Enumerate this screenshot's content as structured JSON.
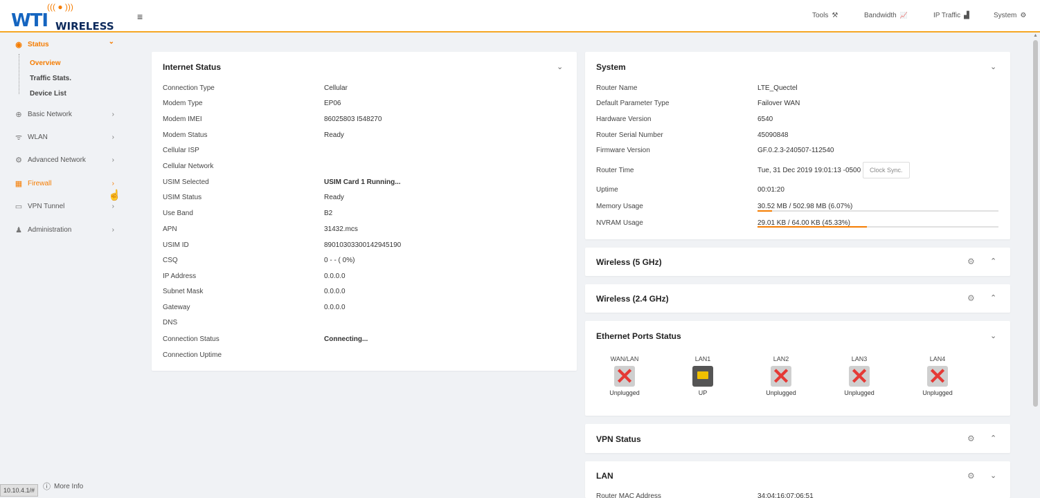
{
  "brand": {
    "logo_main": "WTI",
    "logo_sub": "WIRELESS",
    "logo_waves": "((( ● )))"
  },
  "topnav": [
    {
      "label": "Tools",
      "icon": "⚒"
    },
    {
      "label": "Bandwidth",
      "icon": "📈"
    },
    {
      "label": "IP Traffic",
      "icon": "▟"
    },
    {
      "label": "System",
      "icon": "⚙"
    }
  ],
  "sidebar": {
    "items": [
      {
        "label": "Status",
        "icon": "◉",
        "chev": "⌄"
      },
      {
        "label": "Basic Network",
        "icon": "⊕",
        "chev": "›"
      },
      {
        "label": "WLAN",
        "icon": "ᯤ",
        "chev": "›"
      },
      {
        "label": "Advanced Network",
        "icon": "⚙",
        "chev": "›"
      },
      {
        "label": "Firewall",
        "icon": "▦",
        "chev": "›"
      },
      {
        "label": "VPN Tunnel",
        "icon": "▭",
        "chev": "›"
      },
      {
        "label": "Administration",
        "icon": "♟",
        "chev": "›"
      }
    ],
    "sub_items": [
      "Overview",
      "Traffic Stats.",
      "Device List"
    ],
    "more_info": "More Info",
    "url": "10.10.4.1/#"
  },
  "internet_status": {
    "title": "Internet Status",
    "rows": [
      {
        "label": "Connection Type",
        "value": "Cellular"
      },
      {
        "label": "Modem Type",
        "value": "EP06"
      },
      {
        "label": "Modem IMEI",
        "value": "86025803 I548270"
      },
      {
        "label": "Modem Status",
        "value": "Ready"
      },
      {
        "label": "Cellular ISP",
        "value": ""
      },
      {
        "label": "Cellular Network",
        "value": ""
      },
      {
        "label": "USIM Selected",
        "value": "USIM Card 1 Running..."
      },
      {
        "label": "USIM Status",
        "value": "Ready"
      },
      {
        "label": "Use Band",
        "value": "B2"
      },
      {
        "label": "APN",
        "value": "31432.mcs"
      },
      {
        "label": "USIM ID",
        "value": "89010303300142945190"
      },
      {
        "label": "CSQ",
        "value": "0 - - ( 0%)"
      },
      {
        "label": "IP Address",
        "value": "0.0.0.0"
      },
      {
        "label": "Subnet Mask",
        "value": "0.0.0.0"
      },
      {
        "label": "Gateway",
        "value": "0.0.0.0"
      },
      {
        "label": "DNS",
        "value": ""
      },
      {
        "label": "Connection Status",
        "value": "Connecting..."
      },
      {
        "label": "Connection Uptime",
        "value": ""
      }
    ]
  },
  "system": {
    "title": "System",
    "rows": [
      {
        "label": "Router Name",
        "value": "LTE_Quectel"
      },
      {
        "label": "Default Parameter Type",
        "value": "Failover WAN"
      },
      {
        "label": "Hardware Version",
        "value": "6540"
      },
      {
        "label": "Router Serial Number",
        "value": "45090848"
      },
      {
        "label": "Firmware Version",
        "value": "GF.0.2.3-240507-112540"
      },
      {
        "label": "Router Time",
        "value": "Tue, 31 Dec 2019 19:01:13 -0500"
      },
      {
        "label": "Uptime",
        "value": "00:01:20"
      },
      {
        "label": "Memory Usage",
        "value": "30.52 MB / 502.98 MB (6.07%)",
        "percent": 6.07
      },
      {
        "label": "NVRAM Usage",
        "value": "29.01 KB / 64.00 KB (45.33%)",
        "percent": 45.33
      }
    ],
    "clock_sync": "Clock Sync."
  },
  "wireless5": {
    "title": "Wireless (5 GHz)"
  },
  "wireless24": {
    "title": "Wireless (2.4 GHz)"
  },
  "ethernet": {
    "title": "Ethernet Ports Status",
    "ports": [
      {
        "label": "WAN/LAN",
        "status": "Unplugged"
      },
      {
        "label": "LAN1",
        "status": "UP"
      },
      {
        "label": "LAN2",
        "status": "Unplugged"
      },
      {
        "label": "LAN3",
        "status": "Unplugged"
      },
      {
        "label": "LAN4",
        "status": "Unplugged"
      }
    ]
  },
  "vpn": {
    "title": "VPN Status"
  },
  "lan": {
    "title": "LAN",
    "first_row_label": "Router MAC Address",
    "first_row_value": "34:04:16:07:06:51"
  },
  "colors": {
    "accent": "#f57c00",
    "brand_blue": "#1565c0",
    "error": "#e53935"
  }
}
